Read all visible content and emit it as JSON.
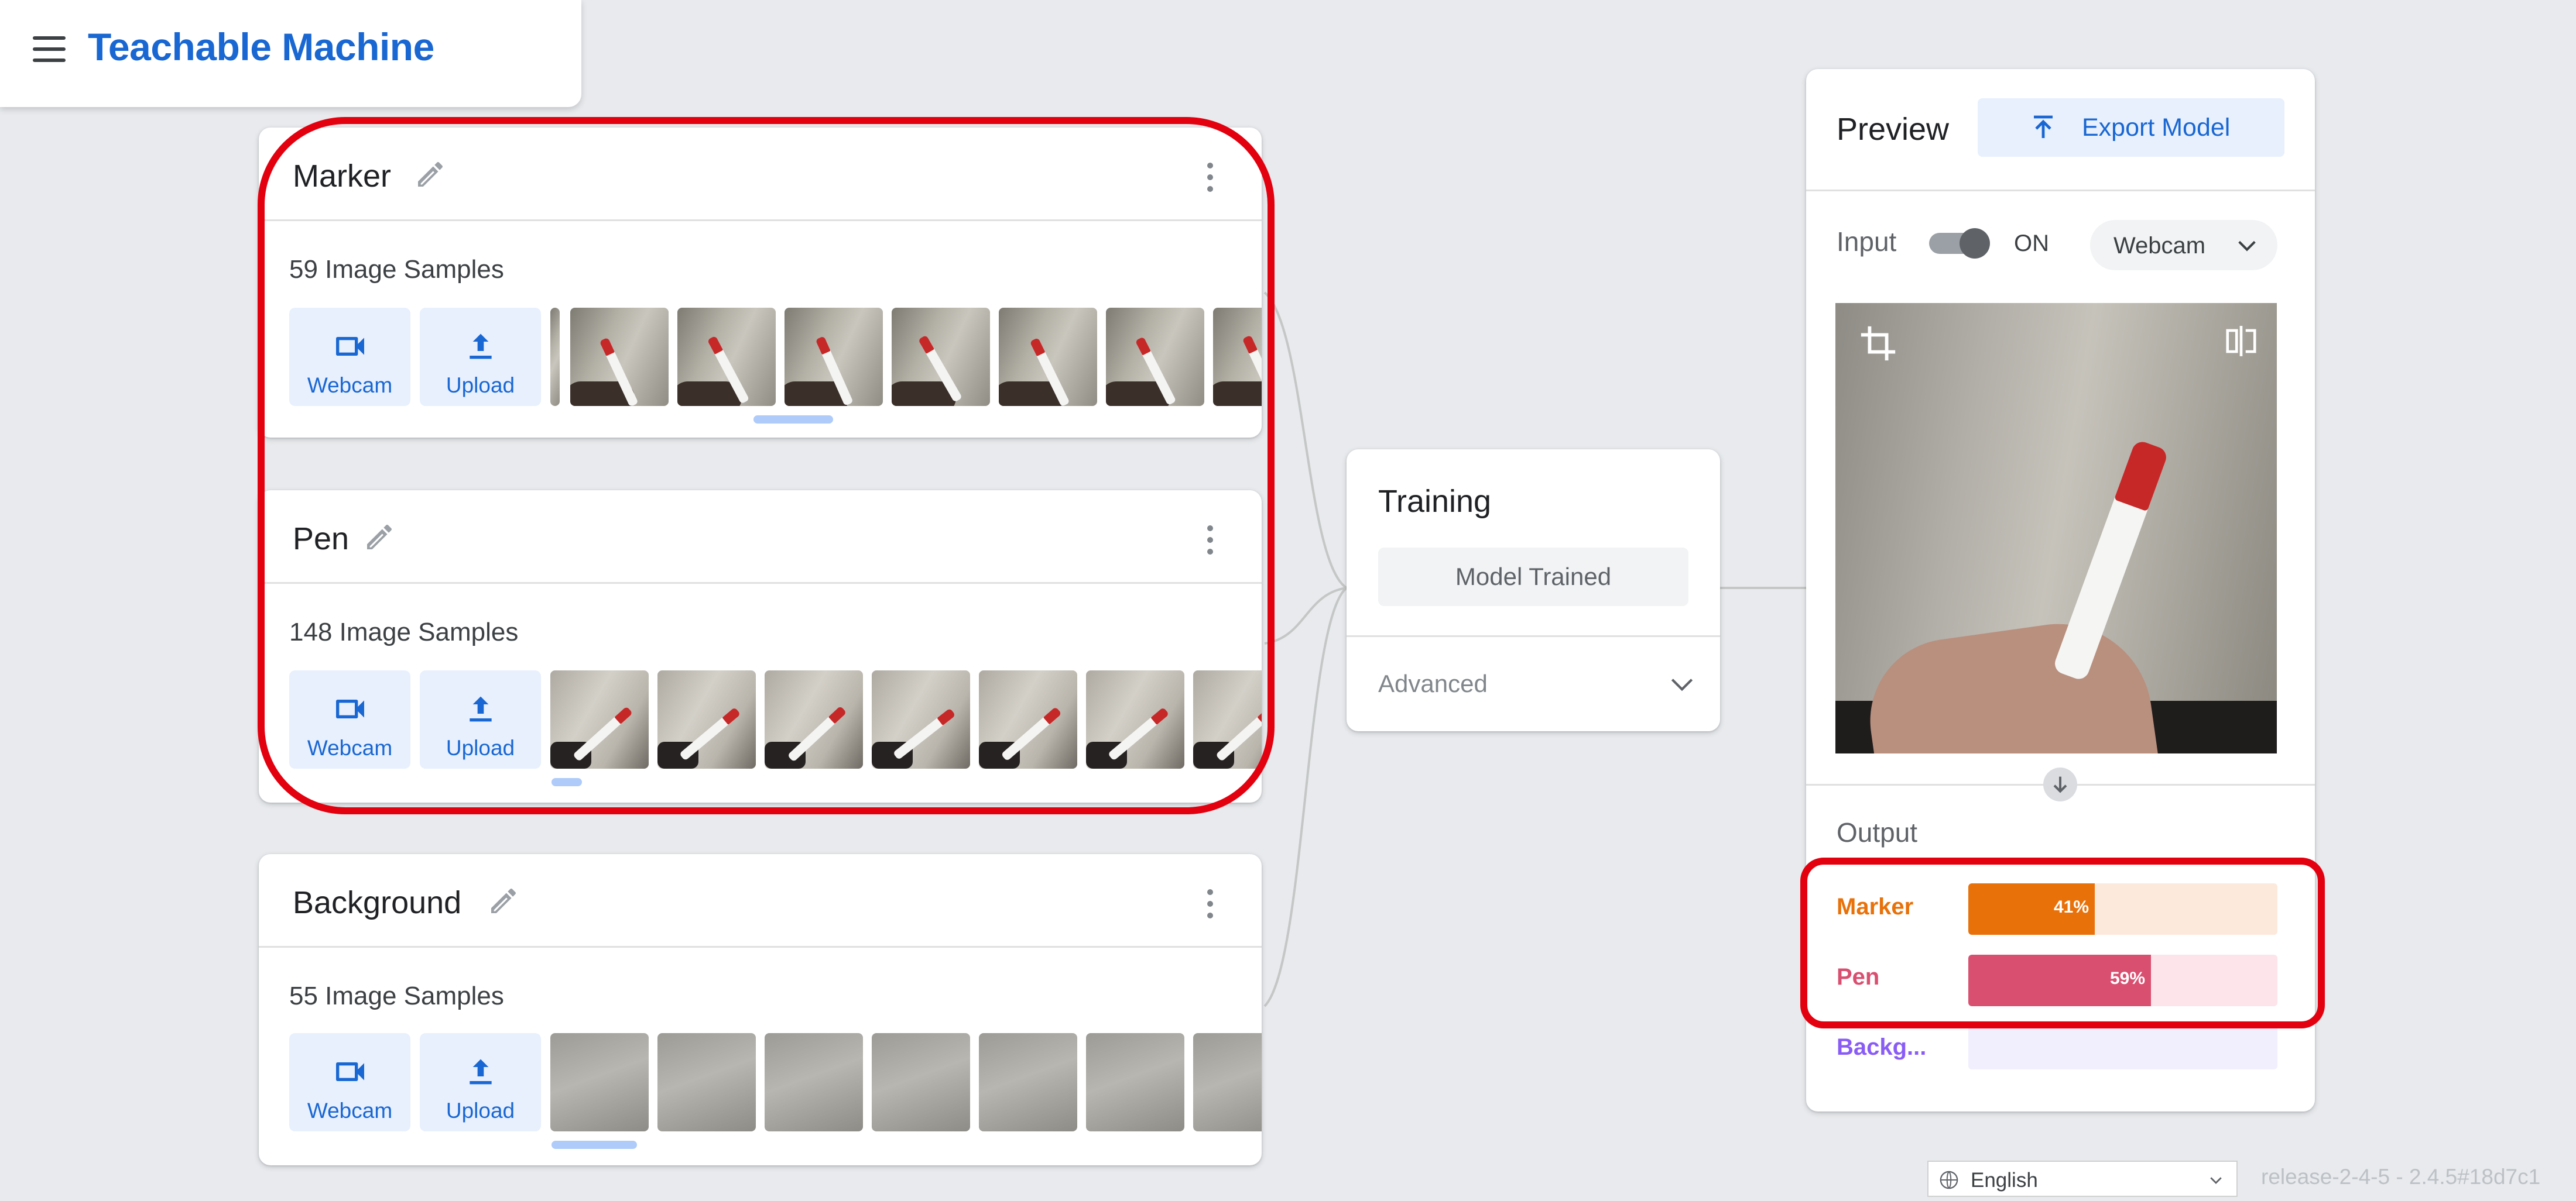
{
  "app": {
    "title": "Teachable Machine",
    "menu_icon": "hamburger-menu-icon"
  },
  "classes": [
    {
      "name": "Marker",
      "samples_text": "59 Image Samples",
      "webcam_label": "Webcam",
      "upload_label": "Upload"
    },
    {
      "name": "Pen",
      "samples_text": "148 Image Samples",
      "webcam_label": "Webcam",
      "upload_label": "Upload"
    },
    {
      "name": "Background",
      "samples_text": "55 Image Samples",
      "webcam_label": "Webcam",
      "upload_label": "Upload"
    }
  ],
  "training": {
    "title": "Training",
    "status_button": "Model Trained",
    "advanced_label": "Advanced"
  },
  "preview": {
    "title": "Preview",
    "export_label": "Export Model",
    "input_label": "Input",
    "toggle_state": "ON",
    "source_select": "Webcam",
    "output_label": "Output",
    "outputs": [
      {
        "name": "Marker",
        "percent_text": "41%",
        "value": 0.41,
        "color": "#e8710a",
        "track": "#fde8dc"
      },
      {
        "name": "Pen",
        "percent_text": "59%",
        "value": 0.59,
        "color": "#d94f70",
        "track": "#fce4ea"
      },
      {
        "name": "Backg...",
        "percent_text": "",
        "value": 0.0,
        "color": "#8a5cf6",
        "track": "#f1eefe"
      }
    ]
  },
  "footer": {
    "language": "English",
    "version": "release-2-4-5 - 2.4.5#18d7c1"
  },
  "colors": {
    "accent": "#1967d2",
    "highlight": "#e3000f"
  }
}
